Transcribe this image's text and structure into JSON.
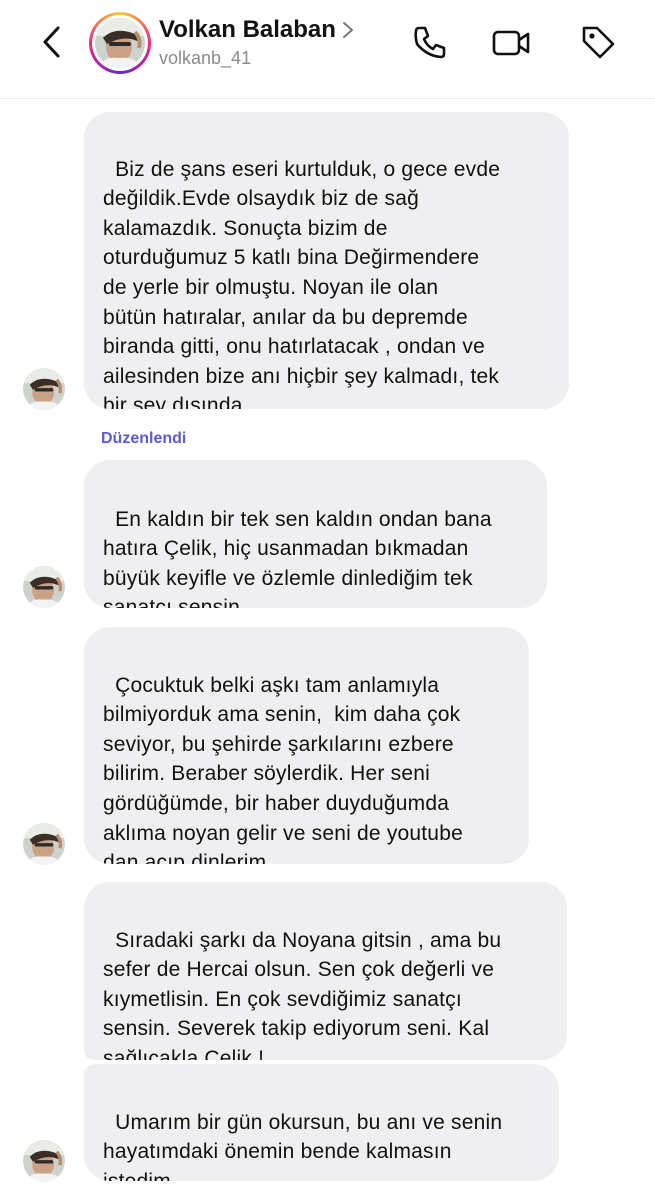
{
  "header": {
    "name": "Volkan Balaban",
    "username": "volkanb_41"
  },
  "messages": [
    {
      "text": "Biz de şans eseri kurtulduk, o gece evde\ndeğildik.Evde olsaydık biz de sağ\nkalamazdık. Sonuçta bizim de\noturduğumuz 5 katlı bina Değirmendere\nde yerle bir olmuştu. Noyan ile olan\nbütün hatıralar, anılar da bu depremde\nbiranda gitti, onu hatırlatacak , ondan ve\nailesinden bize anı hiçbir şey kalmadı, tek\nbir şey dışında."
    },
    {
      "edited_label": "Düzenlendi",
      "text": "En kaldın bir tek sen kaldın ondan bana\nhatıra Çelik, hiç usanmadan bıkmadan\nbüyük keyifle ve özlemle dinlediğim tek\nsanatçı sensin."
    },
    {
      "text": "Çocuktuk belki aşkı tam anlamıyla\nbilmiyorduk ama senin,  kim daha çok\nseviyor, bu şehirde şarkılarını ezbere\nbilirim. Beraber söylerdik. Her seni\ngördüğümde, bir haber duyduğumda\naklıma noyan gelir ve seni de youtube\ndan açıp dinlerim."
    },
    {
      "text": "Sıradaki şarkı da Noyana gitsin , ama bu\nsefer de Hercai olsun. Sen çok değerli ve\nkıymetlisin. En çok sevdiğimiz sanatçı\nsensin. Severek takip ediyorum seni. Kal\nsağlıcakla Çelik !"
    },
    {
      "text": "Umarım bir gün okursun, bu anı ve senin\nhayatımdaki önemin bende kalmasın\nistedim."
    }
  ],
  "icons": {
    "back": "chevron-left-icon",
    "profile_chevron": "chevron-right-icon",
    "call": "phone-icon",
    "video": "video-camera-icon",
    "tag": "tag-icon"
  },
  "colors": {
    "bubble_bg": "#efeff1",
    "edited_label": "#5b5bd6",
    "username": "#8a8a8a"
  }
}
